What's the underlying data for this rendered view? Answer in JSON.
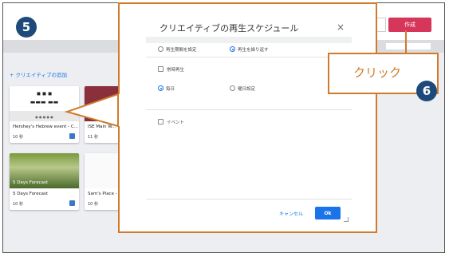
{
  "steps": {
    "step5": "5",
    "step6": "6"
  },
  "header": {
    "back": "✎",
    "create_label": "作成"
  },
  "toolbar": {
    "add_creative": "+ クリエイティブの追加"
  },
  "cards": [
    {
      "title": "Hershey's Hebrew event - C...",
      "duration": "10 秒"
    },
    {
      "title": "ISE Main W...",
      "duration": "11 秒"
    },
    {
      "title": "5 Days Forecast",
      "duration": "10 秒",
      "thumb_label": "5 Days Forecast"
    },
    {
      "title": "Sam's Place - M...",
      "duration": "10 秒"
    }
  ],
  "modal": {
    "title": "クリエイティブの再生スケジュール",
    "close": "×",
    "opt_period": "再生期間を設定",
    "opt_repeat": "再生を繰り返す",
    "chk_always": "常時再生",
    "opt_daily": "毎日",
    "opt_weekday": "曜日設定",
    "chk_event": "イベント",
    "cancel": "キャンセル",
    "ok": "Ok"
  },
  "callout": {
    "text": "クリック"
  },
  "colors": {
    "accent": "#d6365a",
    "callout": "#d07a2a",
    "badge": "#1d4a7a",
    "primary": "#1a73e8"
  }
}
